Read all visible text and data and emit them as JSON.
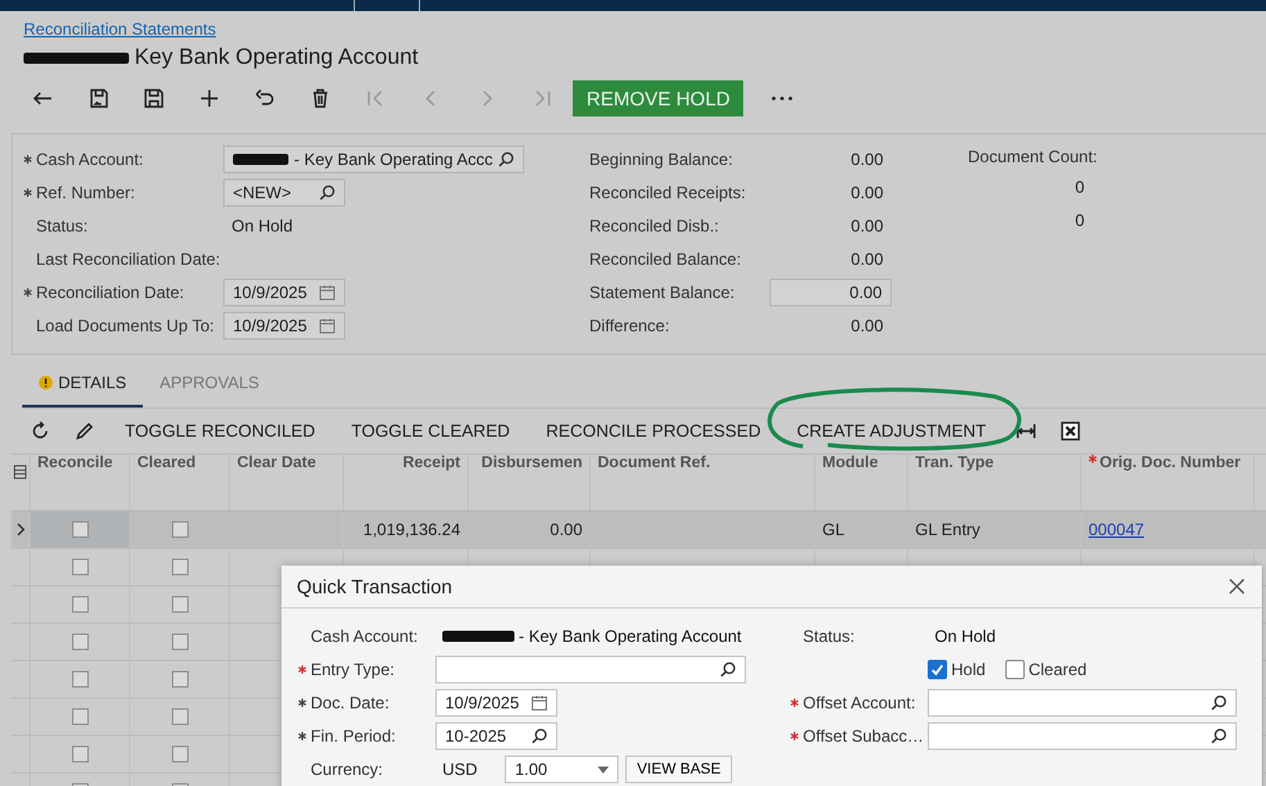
{
  "breadcrumb": "Reconciliation Statements",
  "title": {
    "redacted": true,
    "text": "Key Bank Operating Account"
  },
  "toolbar": {
    "buttons": [
      {
        "kind": "back",
        "disabled": false
      },
      {
        "kind": "save-close",
        "disabled": false
      },
      {
        "kind": "save",
        "disabled": false
      },
      {
        "kind": "add",
        "disabled": false
      },
      {
        "kind": "undo",
        "disabled": false
      },
      {
        "kind": "delete",
        "disabled": false
      },
      {
        "kind": "first",
        "disabled": true
      },
      {
        "kind": "prev",
        "disabled": true
      },
      {
        "kind": "next",
        "disabled": true
      },
      {
        "kind": "last",
        "disabled": true
      }
    ],
    "primary_action": "REMOVE HOLD"
  },
  "summary": {
    "left": [
      {
        "label": "Cash Account:",
        "required": true,
        "kind": "lookup",
        "redacted": true,
        "value": "- Key Bank Operating Accc"
      },
      {
        "label": "Ref. Number:",
        "required": true,
        "kind": "lookup",
        "value": "<NEW>"
      },
      {
        "label": "Status:",
        "required": false,
        "kind": "text",
        "value": "On Hold"
      },
      {
        "label": "Last Reconciliation Date:",
        "required": false,
        "kind": "text"
      },
      {
        "label": "Reconciliation Date:",
        "required": true,
        "kind": "date",
        "value": "10/9/2025"
      },
      {
        "label": "Load Documents Up To:",
        "required": false,
        "kind": "date",
        "value": "10/9/2025"
      }
    ],
    "middle": [
      {
        "label": "Beginning Balance:",
        "kind": "text",
        "value": "0.00"
      },
      {
        "label": "Reconciled Receipts:",
        "kind": "text",
        "value": "0.00"
      },
      {
        "label": "Reconciled Disb.:",
        "kind": "text",
        "value": "0.00"
      },
      {
        "label": "Reconciled Balance:",
        "kind": "text",
        "value": "0.00"
      },
      {
        "label": "Statement Balance:",
        "kind": "input",
        "value": "0.00"
      },
      {
        "label": "Difference:",
        "kind": "text",
        "value": "0.00"
      }
    ],
    "right": {
      "label": "Document Count:",
      "counts": [
        "0",
        "0"
      ]
    }
  },
  "tabs": [
    {
      "label": "DETAILS",
      "selected": true,
      "warning": true
    },
    {
      "label": "APPROVALS",
      "selected": false,
      "warning": false
    }
  ],
  "grid_toolbar": [
    {
      "kind": "refresh"
    },
    {
      "kind": "edit"
    },
    {
      "kind": "text",
      "label": "TOGGLE RECONCILED"
    },
    {
      "kind": "text",
      "label": "TOGGLE CLEARED"
    },
    {
      "kind": "text",
      "label": "RECONCILE PROCESSED"
    },
    {
      "kind": "text",
      "label": "CREATE ADJUSTMENT",
      "circled": true
    },
    {
      "kind": "fit"
    },
    {
      "kind": "excel"
    }
  ],
  "table": {
    "columns": [
      {
        "label": "Reconcile",
        "required": false
      },
      {
        "label": "Cleared",
        "required": false
      },
      {
        "label": "Clear Date",
        "required": false
      },
      {
        "label": "Receipt",
        "required": false
      },
      {
        "label": "Disbursemen",
        "required": false
      },
      {
        "label": "Document Ref.",
        "required": false
      },
      {
        "label": "Module",
        "required": false
      },
      {
        "label": "Tran. Type",
        "required": false
      },
      {
        "label": "Orig. Doc. Number",
        "required": true
      }
    ],
    "rows": [
      {
        "selected": true,
        "reconcile": false,
        "cleared": false,
        "receipt": "1,019,136.24",
        "disbursement": "0.00",
        "module": "GL",
        "tran_type": "GL Entry",
        "orig_doc": "000047"
      },
      {
        "selected": false,
        "reconcile": false,
        "cleared": false
      },
      {
        "selected": false,
        "reconcile": false,
        "cleared": false
      },
      {
        "selected": false,
        "reconcile": false,
        "cleared": false
      },
      {
        "selected": false,
        "reconcile": false,
        "cleared": false
      },
      {
        "selected": false,
        "reconcile": false,
        "cleared": false
      },
      {
        "selected": false,
        "reconcile": false,
        "cleared": false
      },
      {
        "selected": false,
        "reconcile": false,
        "cleared": false
      }
    ]
  },
  "dialog": {
    "title": "Quick Transaction",
    "left": [
      {
        "label": "Cash Account:",
        "required": false,
        "kind": "text",
        "redacted": true,
        "value": "- Key Bank Operating Account"
      },
      {
        "label": "Entry Type:",
        "required": true,
        "kind": "lookup"
      },
      {
        "label": "Doc. Date:",
        "required": true,
        "kind": "date",
        "value": "10/9/2025"
      },
      {
        "label": "Fin. Period:",
        "required": true,
        "kind": "lookup",
        "value": "10-2025"
      },
      {
        "label": "Currency:",
        "required": false,
        "kind": "currency",
        "value": "USD",
        "rate": "1.00",
        "button": "VIEW BASE"
      }
    ],
    "right": [
      {
        "label": "Status:",
        "required": false,
        "kind": "text",
        "value": "On Hold"
      },
      {
        "kind": "checks",
        "checks": [
          {
            "label": "Hold",
            "checked": true
          },
          {
            "label": "Cleared",
            "checked": false
          }
        ]
      },
      {
        "label": "Offset Account:",
        "required": true,
        "kind": "lookup"
      },
      {
        "label": "Offset Subacc…",
        "required": true,
        "kind": "lookup"
      }
    ]
  }
}
